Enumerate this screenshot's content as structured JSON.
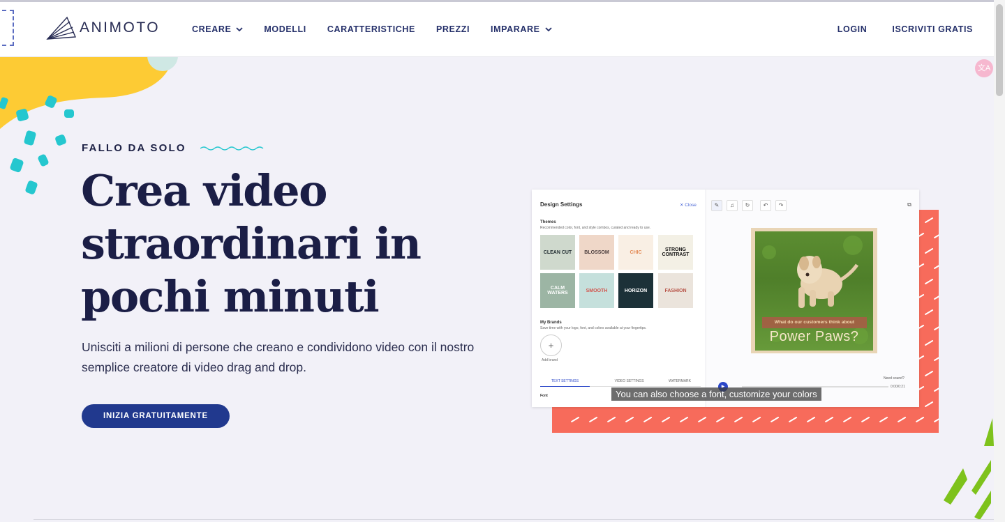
{
  "header": {
    "logo_text": "ANIMOTO",
    "nav": [
      {
        "label": "CREARE",
        "dropdown": true
      },
      {
        "label": "MODELLI",
        "dropdown": false
      },
      {
        "label": "CARATTERISTICHE",
        "dropdown": false
      },
      {
        "label": "PREZZI",
        "dropdown": false
      },
      {
        "label": "IMPARARE",
        "dropdown": true
      }
    ],
    "login": "LOGIN",
    "signup": "ISCRIVITI GRATIS"
  },
  "hero": {
    "kicker": "FALLO DA SOLO",
    "headline": "Crea video straordinari in pochi minuti",
    "subtext": "Unisciti a milioni di persone che creano e condividono video con il nostro semplice creatore di video drag and drop.",
    "cta": "INIZIA GRATUITAMENTE"
  },
  "preview": {
    "panel_title": "Design Settings",
    "close": "Close",
    "themes_label": "Themes",
    "themes_desc": "Recommended color, font, and style combos, curated and ready to use.",
    "themes": [
      {
        "name": "CLEAN CUT",
        "bg": "#cfd9cd",
        "fg": "#1e2a2f"
      },
      {
        "name": "BLOSSOM",
        "bg": "#efd7c8",
        "fg": "#4a3c3c"
      },
      {
        "name": "CHIC",
        "bg": "#f9efe4",
        "fg": "#e38b58"
      },
      {
        "name": "STRONG CONTRAST",
        "bg": "#f3f0e5",
        "fg": "#111111"
      },
      {
        "name": "CALM WATERS",
        "bg": "#9cb5a4",
        "fg": "#ffffff"
      },
      {
        "name": "SMOOTH",
        "bg": "#c5e0dc",
        "fg": "#d3544c"
      },
      {
        "name": "HORIZON",
        "bg": "#1c3138",
        "fg": "#ffffff"
      },
      {
        "name": "FASHION",
        "bg": "#ebe4dc",
        "fg": "#b85549"
      }
    ],
    "brands_label": "My Brands",
    "brands_desc": "Save time with your logo, font, and colors available at your fingertips.",
    "add_brand": "Add brand",
    "tabs": [
      "TEXT SETTINGS",
      "VIDEO SETTINGS",
      "WATERMARK"
    ],
    "font_label": "Font",
    "video_caption": "What do our customers think about",
    "video_title": "Power Paws?",
    "need_sound": "Need sound?",
    "time": "0:00/0:21",
    "subtitle": "You can also choose a font, customize your colors"
  },
  "colors": {
    "brand_navy": "#21398e",
    "coral": "#f76b5b",
    "yellow": "#fdcb34",
    "teal": "#25c7cf",
    "pink": "#f0468a",
    "lime": "#7ec21c"
  },
  "icons": [
    "chevron-down-icon",
    "translate-icon",
    "pen-icon",
    "music-icon",
    "refresh-icon",
    "undo-icon",
    "redo-icon",
    "external-link-icon",
    "play-icon"
  ]
}
